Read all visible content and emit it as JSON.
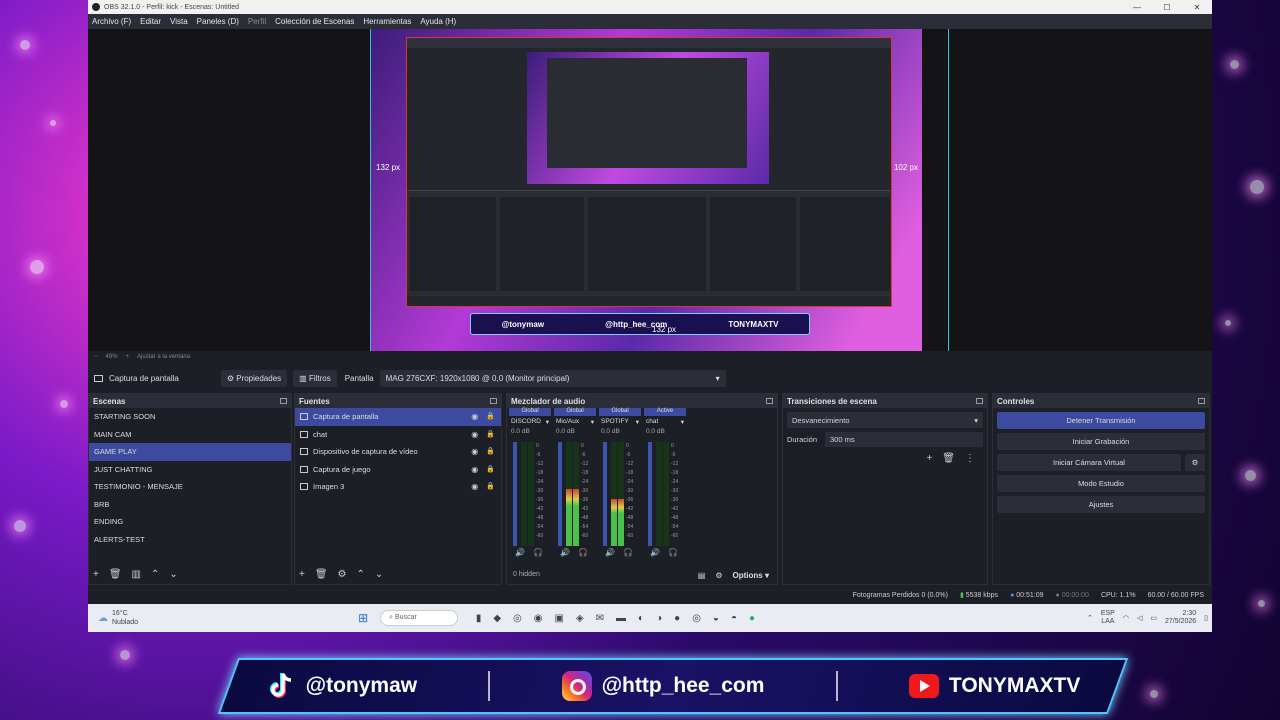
{
  "window": {
    "title": "OBS 32.1.0 - Perfil: kick - Escenas: Untitled",
    "controls": [
      "—",
      "☐",
      "✕"
    ]
  },
  "menu": [
    "Archivo (F)",
    "Editar",
    "Vista",
    "Paneles (D)",
    "Perfil",
    "Colección de Escenas",
    "Herramientas",
    "Ayuda (H)"
  ],
  "preview": {
    "left_px": "132 px",
    "right_px": "102 px",
    "bottom_px": "132 px",
    "mini_banner": [
      "@tonymaw",
      "@http_hee_com",
      "TONYMAXTV"
    ]
  },
  "zoom": {
    "value": "49%",
    "fit_label": "Ajustar a la ventana"
  },
  "source_bar": {
    "source_name": "Captura de pantalla",
    "properties": "Propiedades",
    "filters": "Filtros",
    "screen_label": "Pantalla",
    "screen_value": "MAG 276CXF: 1920x1080 @ 0,0 (Monitor principal)"
  },
  "scenes": {
    "title": "Escenas",
    "items": [
      "STARTING SOON",
      "MAIN CAM",
      "GAME PLAY",
      "JUST CHATTING",
      "TESTIMONIO - MENSAJE",
      "BRB",
      "ENDING",
      "ALERTS-TEST"
    ],
    "selected": 2
  },
  "sources": {
    "title": "Fuentes",
    "items": [
      "Captura de pantalla",
      "chat",
      "Dispositivo de captura de vídeo",
      "Captura de juego",
      "Imagen 3"
    ],
    "selected": 0
  },
  "mixer": {
    "title": "Mezclador de audio",
    "channels": [
      {
        "group": "Global",
        "name": "DISCORD",
        "db": "0.0 dB",
        "level": 0.0
      },
      {
        "group": "Global",
        "name": "Mic/Aux",
        "db": "0.0 dB",
        "level": 0.55
      },
      {
        "group": "Global",
        "name": "SPOTIFY",
        "db": "0.0 dB",
        "level": 0.45
      },
      {
        "group": "Active",
        "name": "chat",
        "db": "0.0 dB",
        "level": 0.0
      }
    ],
    "scale": [
      "0",
      "-6",
      "-12",
      "-18",
      "-24",
      "-30",
      "-36",
      "-42",
      "-48",
      "-54",
      "-60"
    ],
    "hidden": "0 hidden",
    "options": "Options"
  },
  "transitions": {
    "title": "Transiciones de escena",
    "selected": "Desvanecimiento",
    "duration_label": "Duración",
    "duration_value": "300 ms"
  },
  "controls": {
    "title": "Controles",
    "stop_stream": "Detener Transmisión",
    "start_record": "Iniciar Grabación",
    "virtual_cam": "Iniciar Cámara Virtual",
    "studio": "Modo Estudio",
    "settings": "Ajustes"
  },
  "status": {
    "dropped": "Fotogramas Perdidos 0 (0.0%)",
    "bitrate": "5538 kbps",
    "stream_time": "00:51:09",
    "rec_time": "00:00:00",
    "cpu": "CPU: 1.1%",
    "fps": "60.00 / 60.00 FPS"
  },
  "taskbar": {
    "weather": "16°C",
    "weather_desc": "Nublado",
    "search": "Buscar",
    "lang1": "ESP",
    "lang2": "LAA",
    "time": "2:30",
    "date": "27/5/2026"
  },
  "banner": {
    "tiktok": "@tonymaw",
    "instagram": "@http_hee_com",
    "youtube": "TONYMAXTV"
  }
}
